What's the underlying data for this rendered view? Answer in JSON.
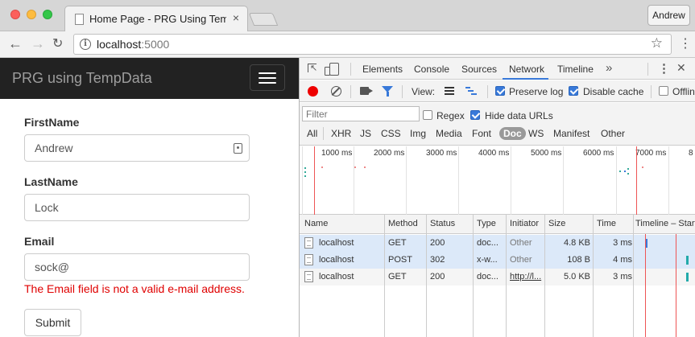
{
  "browser": {
    "tab_title": "Home Page - PRG Using TempData",
    "profile_name": "Andrew",
    "url_host": "localhost",
    "url_port": ":5000"
  },
  "app": {
    "brand": "PRG using TempData",
    "form": {
      "firstname_label": "FirstName",
      "firstname_value": "Andrew",
      "lastname_label": "LastName",
      "lastname_value": "Lock",
      "email_label": "Email",
      "email_value": "sock@",
      "email_error": "The Email field is not a valid e-mail address.",
      "submit_label": "Submit"
    },
    "colors": {
      "navbar": "#222222",
      "error": "#e00000"
    }
  },
  "devtools": {
    "tabs": [
      "Elements",
      "Console",
      "Sources",
      "Network",
      "Timeline"
    ],
    "active_tab": "Network",
    "more": "»",
    "toolbar": {
      "view_label": "View:",
      "preserve_log": "Preserve log",
      "preserve_log_checked": true,
      "disable_cache": "Disable cache",
      "disable_cache_checked": true,
      "offline": "Offlin",
      "offline_checked": false
    },
    "filter": {
      "placeholder": "Filter",
      "regex": "Regex",
      "regex_checked": false,
      "hide_data_urls": "Hide data URLs",
      "hide_data_urls_checked": true,
      "types": [
        "All",
        "XHR",
        "JS",
        "CSS",
        "Img",
        "Media",
        "Font",
        "Doc",
        "WS",
        "Manifest",
        "Other"
      ],
      "selected_type": "Doc"
    },
    "overview_ticks": [
      "1000 ms",
      "2000 ms",
      "3000 ms",
      "4000 ms",
      "5000 ms",
      "6000 ms",
      "7000 ms",
      "8"
    ],
    "columns": [
      "Name",
      "Method",
      "Status",
      "Type",
      "Initiator",
      "Size",
      "Time",
      "Timeline – Start"
    ],
    "requests": [
      {
        "name": "localhost",
        "method": "GET",
        "status": "200",
        "type": "doc...",
        "initiator": "Other",
        "size": "4.8 KB",
        "time": "3 ms"
      },
      {
        "name": "localhost",
        "method": "POST",
        "status": "302",
        "type": "x-w...",
        "initiator": "Other",
        "size": "108 B",
        "time": "4 ms"
      },
      {
        "name": "localhost",
        "method": "GET",
        "status": "200",
        "type": "doc...",
        "initiator": "http://l...",
        "size": "5.0 KB",
        "time": "3 ms"
      }
    ]
  }
}
